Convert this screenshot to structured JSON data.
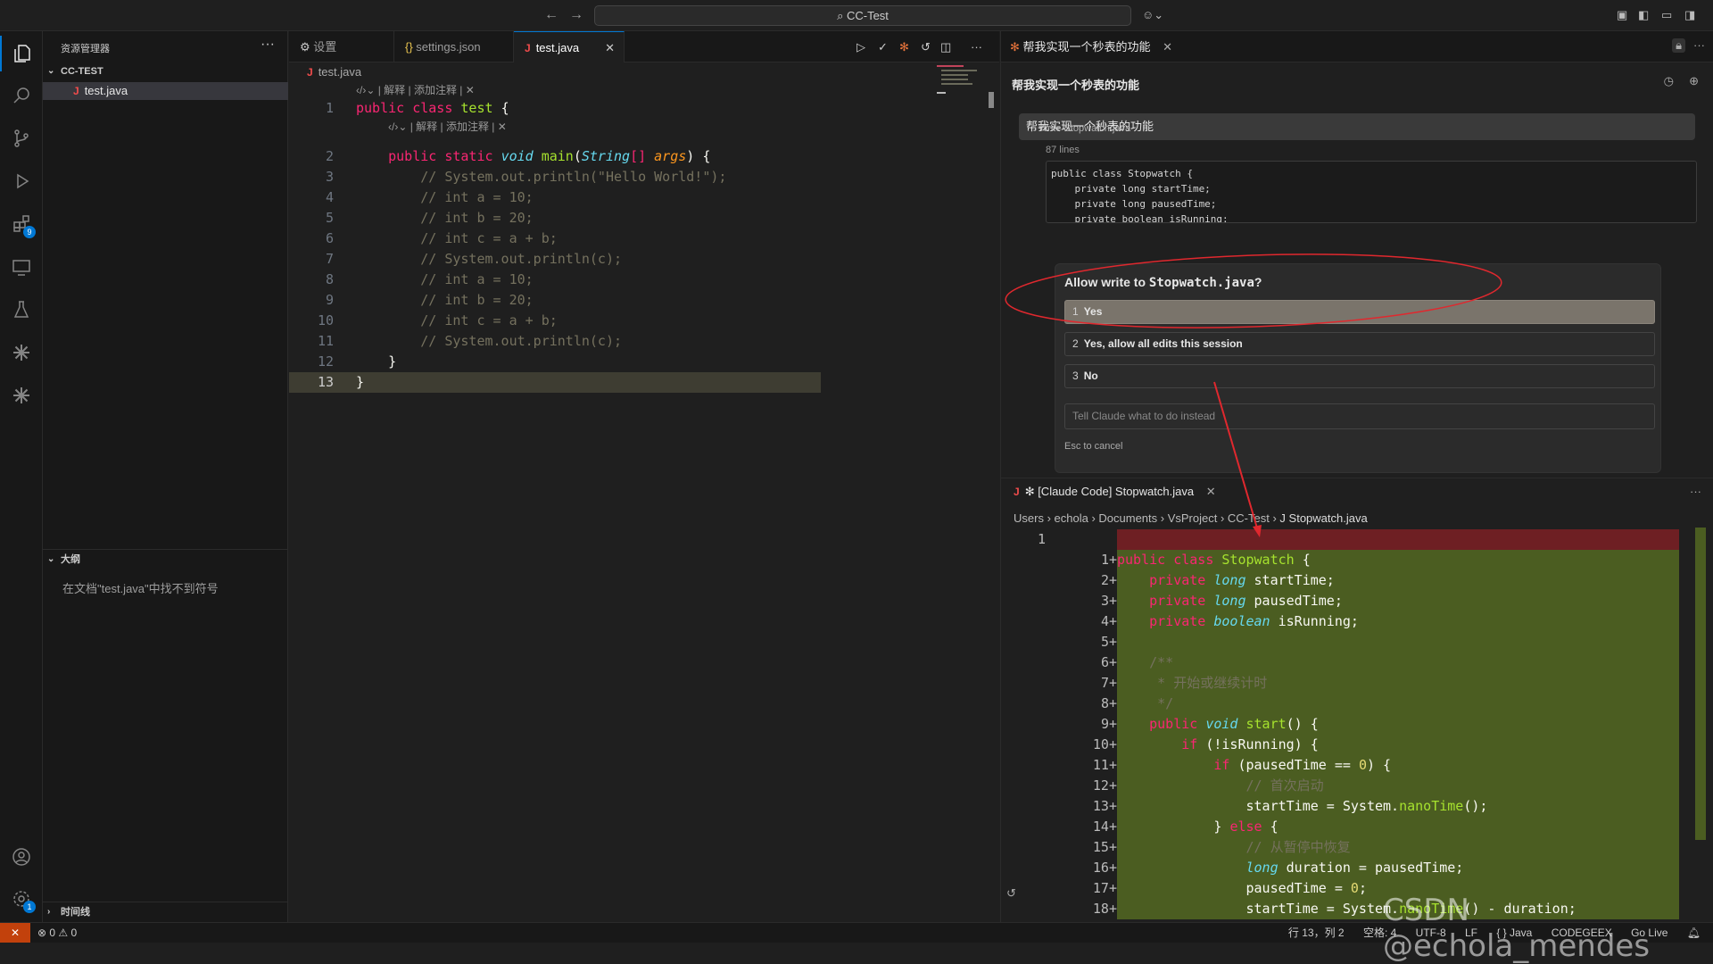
{
  "titlebar": {
    "search": "CC-Test"
  },
  "activity": {
    "extensions_badge": "9",
    "settings_badge": "1"
  },
  "sidebar": {
    "title": "资源管理器",
    "project": "CC-TEST",
    "files": [
      {
        "name": "test.java"
      }
    ],
    "outline_title": "大纲",
    "outline_message": "在文档\"test.java\"中找不到符号",
    "timeline_title": "时间线"
  },
  "editor": {
    "tabs": [
      {
        "label": "设置",
        "icon": "settings-icon"
      },
      {
        "label": "settings.json",
        "icon": "json-icon"
      },
      {
        "label": "test.java",
        "icon": "java-icon",
        "active": true
      }
    ],
    "breadcrumb": "test.java",
    "codelens": "| 解释 | 添加注释 |",
    "lines": [
      {
        "n": "1",
        "tokens": [
          [
            "kw",
            "public "
          ],
          [
            "kw",
            "class "
          ],
          [
            "fn",
            "test "
          ],
          [
            "br",
            "{"
          ]
        ]
      },
      {
        "n": "2",
        "tokens": [
          [
            "br",
            "    "
          ],
          [
            "kw",
            "public "
          ],
          [
            "kw",
            "static "
          ],
          [
            "ty",
            "void "
          ],
          [
            "fn",
            "main"
          ],
          [
            "br",
            "("
          ],
          [
            "ty",
            "String"
          ],
          [
            "kw",
            "[] "
          ],
          [
            "pa",
            "args"
          ],
          [
            "br",
            ") {"
          ]
        ]
      },
      {
        "n": "3",
        "tokens": [
          [
            "cm",
            "        // System.out.println(\"Hello World!\");"
          ]
        ]
      },
      {
        "n": "4",
        "tokens": [
          [
            "cm",
            "        // int a = 10;"
          ]
        ]
      },
      {
        "n": "5",
        "tokens": [
          [
            "cm",
            "        // int b = 20;"
          ]
        ]
      },
      {
        "n": "6",
        "tokens": [
          [
            "cm",
            "        // int c = a + b;"
          ]
        ]
      },
      {
        "n": "7",
        "tokens": [
          [
            "cm",
            "        // System.out.println(c);"
          ]
        ]
      },
      {
        "n": "8",
        "tokens": [
          [
            "cm",
            "        // int a = 10;"
          ]
        ]
      },
      {
        "n": "9",
        "tokens": [
          [
            "cm",
            "        // int b = 20;"
          ]
        ]
      },
      {
        "n": "10",
        "tokens": [
          [
            "cm",
            "        // int c = a + b;"
          ]
        ]
      },
      {
        "n": "11",
        "tokens": [
          [
            "cm",
            "        // System.out.println(c);"
          ]
        ]
      },
      {
        "n": "12",
        "tokens": [
          [
            "br",
            "    }"
          ]
        ]
      },
      {
        "n": "13",
        "tokens": [
          [
            "br",
            "}"
          ]
        ]
      }
    ]
  },
  "claude": {
    "tab_title": "帮我实现一个秒表的功能",
    "panel_title": "帮我实现一个秒表的功能",
    "user_message": "帮我实现一个秒表的功能",
    "overlay_file": "Write Stopwatch.java",
    "lines_count": "87 lines",
    "preview": "public class Stopwatch {\n    private long startTime;\n    private long pausedTime;\n    private boolean isRunning;",
    "permission": {
      "question_prefix": "Allow write to ",
      "question_file": "Stopwatch.java",
      "question_suffix": "?",
      "options": [
        {
          "num": "1",
          "label": "Yes"
        },
        {
          "num": "2",
          "label": "Yes, allow all edits this session"
        },
        {
          "num": "3",
          "label": "No"
        }
      ],
      "placeholder": "Tell Claude what to do instead",
      "esc_hint": "Esc to cancel"
    }
  },
  "diff": {
    "tab_title": "✻ [Claude Code] Stopwatch.java",
    "breadcrumb": [
      "Users",
      "echola",
      "Documents",
      "VsProject",
      "CC-Test",
      "Stopwatch.java"
    ],
    "deleted_line": "1",
    "lines": [
      {
        "n": "1+",
        "tokens": [
          [
            "kw",
            "public "
          ],
          [
            "kw",
            "class "
          ],
          [
            "fn",
            "Stopwatch "
          ],
          [
            "br",
            "{"
          ]
        ]
      },
      {
        "n": "2+",
        "tokens": [
          [
            "br",
            "    "
          ],
          [
            "kw",
            "private "
          ],
          [
            "ty",
            "long "
          ],
          [
            "br",
            "startTime;"
          ]
        ]
      },
      {
        "n": "3+",
        "tokens": [
          [
            "br",
            "    "
          ],
          [
            "kw",
            "private "
          ],
          [
            "ty",
            "long "
          ],
          [
            "br",
            "pausedTime;"
          ]
        ]
      },
      {
        "n": "4+",
        "tokens": [
          [
            "br",
            "    "
          ],
          [
            "kw",
            "private "
          ],
          [
            "ty",
            "boolean "
          ],
          [
            "br",
            "isRunning;"
          ]
        ]
      },
      {
        "n": "5+",
        "tokens": [
          [
            "br",
            ""
          ]
        ]
      },
      {
        "n": "6+",
        "tokens": [
          [
            "cm",
            "    /**"
          ]
        ]
      },
      {
        "n": "7+",
        "tokens": [
          [
            "cm",
            "     * 开始或继续计时"
          ]
        ]
      },
      {
        "n": "8+",
        "tokens": [
          [
            "cm",
            "     */"
          ]
        ]
      },
      {
        "n": "9+",
        "tokens": [
          [
            "br",
            "    "
          ],
          [
            "kw",
            "public "
          ],
          [
            "ty",
            "void "
          ],
          [
            "fn",
            "start"
          ],
          [
            "br",
            "() {"
          ]
        ]
      },
      {
        "n": "10+",
        "tokens": [
          [
            "br",
            "        "
          ],
          [
            "kw",
            "if "
          ],
          [
            "br",
            "(!isRunning) {"
          ]
        ]
      },
      {
        "n": "11+",
        "tokens": [
          [
            "br",
            "            "
          ],
          [
            "kw",
            "if "
          ],
          [
            "br",
            "(pausedTime == "
          ],
          [
            "st",
            "0"
          ],
          [
            "br",
            ") {"
          ]
        ]
      },
      {
        "n": "12+",
        "tokens": [
          [
            "cm",
            "                // 首次启动"
          ]
        ]
      },
      {
        "n": "13+",
        "tokens": [
          [
            "br",
            "                startTime = System."
          ],
          [
            "fn",
            "nanoTime"
          ],
          [
            "br",
            "();"
          ]
        ]
      },
      {
        "n": "14+",
        "tokens": [
          [
            "br",
            "            } "
          ],
          [
            "kw",
            "else "
          ],
          [
            "br",
            "{"
          ]
        ]
      },
      {
        "n": "15+",
        "tokens": [
          [
            "cm",
            "                // 从暂停中恢复"
          ]
        ]
      },
      {
        "n": "16+",
        "tokens": [
          [
            "br",
            "                "
          ],
          [
            "ty",
            "long "
          ],
          [
            "br",
            "duration = pausedTime;"
          ]
        ]
      },
      {
        "n": "17+",
        "tokens": [
          [
            "br",
            "                pausedTime = "
          ],
          [
            "st",
            "0"
          ],
          [
            "br",
            ";"
          ]
        ]
      },
      {
        "n": "18+",
        "tokens": [
          [
            "br",
            "                startTime = System."
          ],
          [
            "fn",
            "nanoTime"
          ],
          [
            "br",
            "() - duration;"
          ]
        ]
      }
    ]
  },
  "statusbar": {
    "problems": "⊗ 0 ⚠ 0",
    "position": "行 13，列 2",
    "spaces": "空格: 4",
    "encoding": "UTF-8",
    "eol": "LF",
    "language": "{ } Java",
    "codegeex": "CODEGEEX",
    "golive": "Go Live"
  },
  "watermark": "CSDN @echola_mendes",
  "colors": {
    "accent": "#0078d4",
    "diff_added": "#4b5d21",
    "diff_removed": "#6e1f23",
    "annotation": "#e0282e"
  }
}
